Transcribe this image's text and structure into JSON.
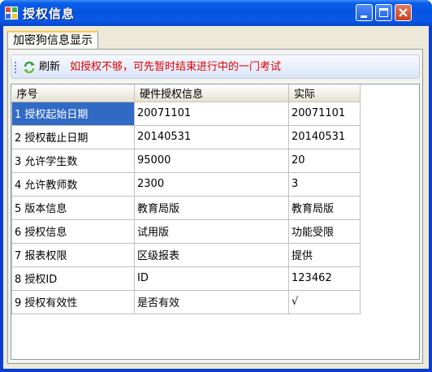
{
  "window": {
    "title": "授权信息"
  },
  "tab": {
    "label": "加密狗信息显示"
  },
  "toolbar": {
    "refresh_label": "刷新",
    "notice": "如授权不够，可先暂时结束进行中的一门考试"
  },
  "table": {
    "headers": [
      "序号",
      "硬件授权信息",
      "实际"
    ],
    "rows": [
      {
        "item": "1 授权起始日期",
        "hardware": "20071101",
        "actual": "20071101"
      },
      {
        "item": "2 授权截止日期",
        "hardware": "20140531",
        "actual": "20140531"
      },
      {
        "item": "3 允许学生数",
        "hardware": "95000",
        "actual": "20"
      },
      {
        "item": "4 允许教师数",
        "hardware": "2300",
        "actual": "3"
      },
      {
        "item": "5 版本信息",
        "hardware": "教育局版",
        "actual": "教育局版"
      },
      {
        "item": "6 授权信息",
        "hardware": "试用版",
        "actual": "功能受限"
      },
      {
        "item": "7 报表权限",
        "hardware": "区级报表",
        "actual": "提供"
      },
      {
        "item": "8 授权ID",
        "hardware": "ID",
        "actual": "123462"
      },
      {
        "item": "9 授权有效性",
        "hardware": "是否有效",
        "actual": "√"
      }
    ]
  },
  "colors": {
    "titlebar": "#0654e0",
    "notice": "#e00000",
    "selection": "#316ac5"
  }
}
